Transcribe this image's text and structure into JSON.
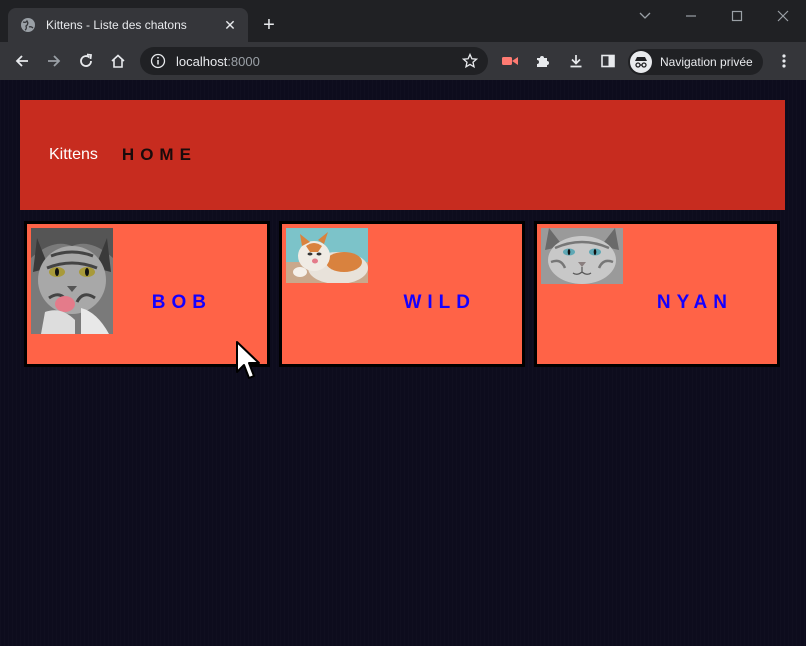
{
  "browser": {
    "tab_title": "Kittens - Liste des chatons",
    "new_tab_label": "+",
    "address_host": "localhost",
    "address_port": ":8000",
    "incognito_label": "Navigation privée",
    "tab_close_label": "✕"
  },
  "page": {
    "brand": "Kittens",
    "nav_home": "HOME"
  },
  "kittens": [
    {
      "name": "BOB",
      "photo_icon": "tabby-cat-photo"
    },
    {
      "name": "WILD",
      "photo_icon": "ginger-cat-photo"
    },
    {
      "name": "NYAN",
      "photo_icon": "grey-cat-photo"
    }
  ],
  "colors": {
    "navbar": "#c72c1f",
    "card": "#ff6347",
    "card_name": "#1500ff",
    "page_bg": "#0d0c1d"
  }
}
